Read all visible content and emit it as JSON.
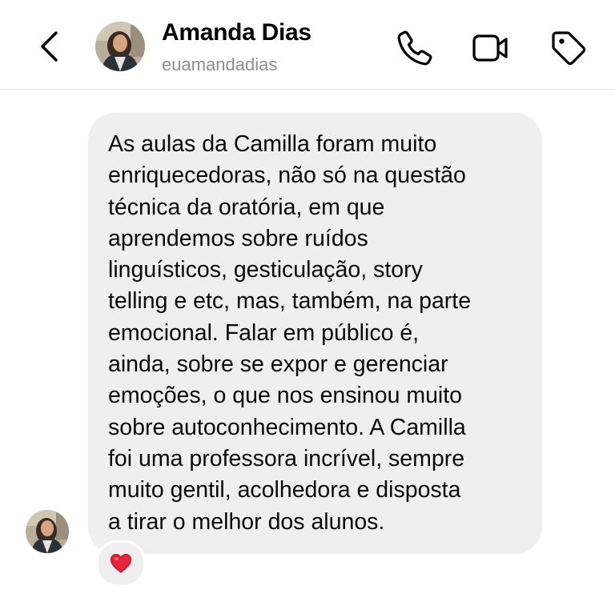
{
  "header": {
    "contact_name": "Amanda Dias",
    "contact_handle": "euamandadias",
    "icons": {
      "back": "chevron-left-icon",
      "call": "phone-icon",
      "video": "video-camera-icon",
      "tag": "tag-icon"
    }
  },
  "message": {
    "lines": [
      "As aulas da Camilla foram muito",
      "enriquecedoras, não só na questão",
      "técnica da oratória, em que",
      "aprendemos sobre ruídos",
      "linguísticos, gesticulação, story",
      "telling e etc, mas, também, na parte",
      "emocional. Falar em público é,",
      "ainda, sobre se expor e gerenciar",
      "emoções, o que nos ensinou muito",
      "sobre autoconhecimento. A Camilla",
      "foi uma professora incrível, sempre",
      "muito gentil, acolhedora e disposta",
      "a tirar o melhor dos alunos."
    ],
    "reaction": "❤️"
  },
  "colors": {
    "bubble": "#efefef",
    "handle": "#8e8e8e",
    "divider": "#e6e6e6",
    "heart": "#e3263b"
  }
}
